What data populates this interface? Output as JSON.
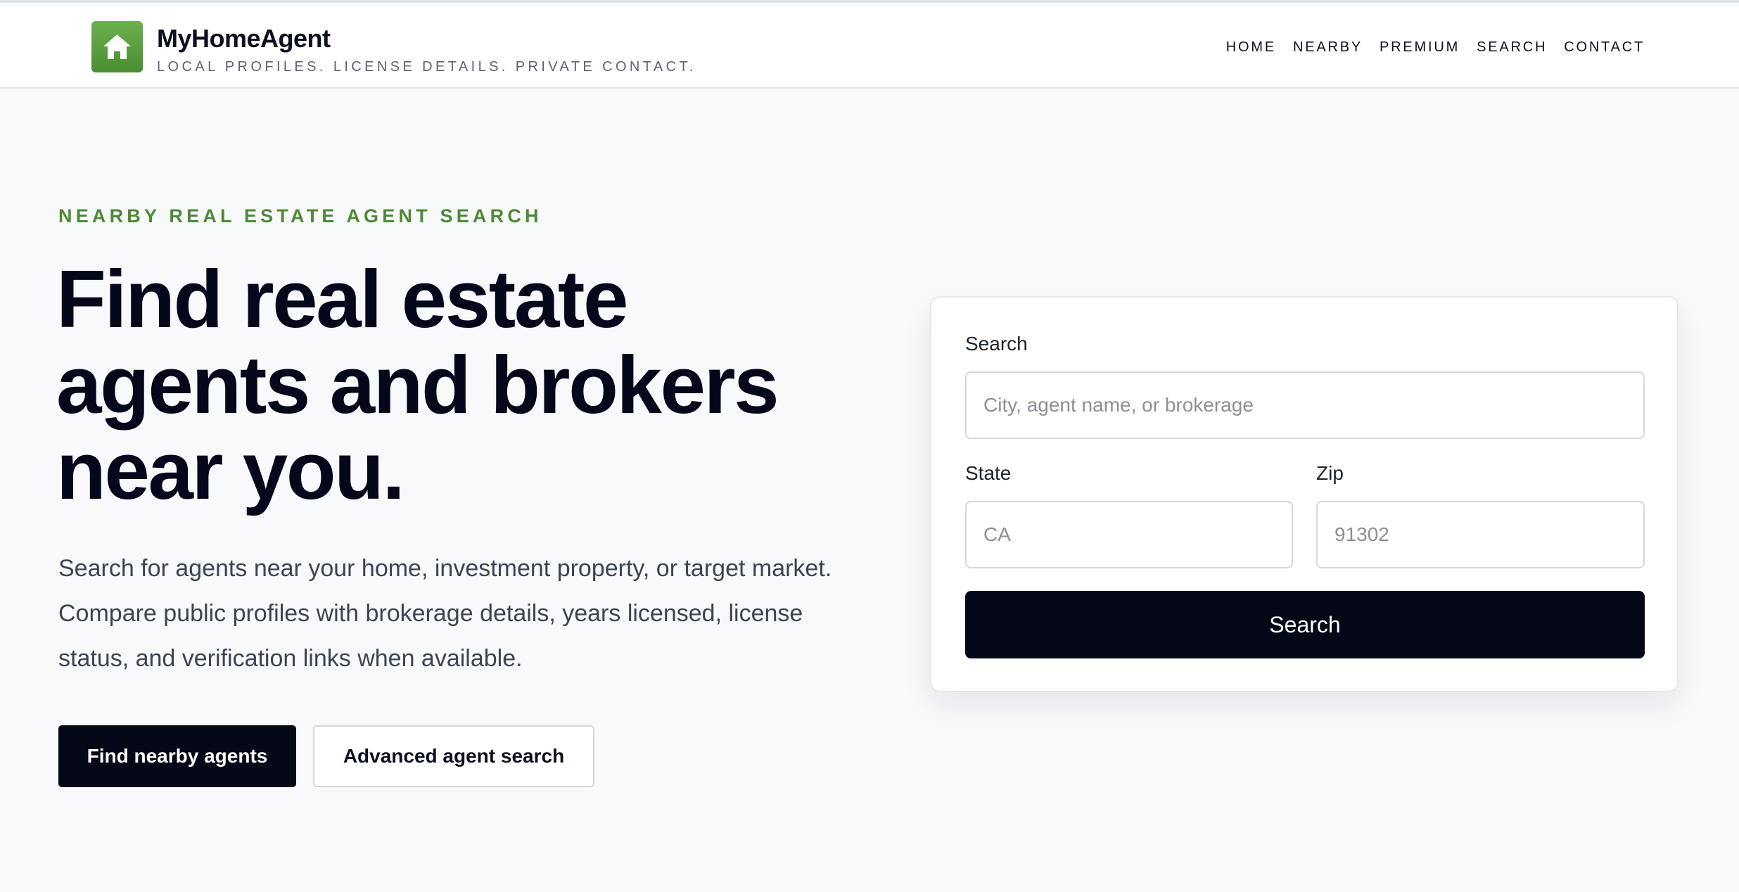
{
  "brand": {
    "name": "MyHomeAgent",
    "tagline": "LOCAL PROFILES. LICENSE DETAILS. PRIVATE CONTACT.",
    "logo_icon": "house-icon",
    "logo_color": "#5a9e40"
  },
  "nav": {
    "items": [
      {
        "label": "HOME"
      },
      {
        "label": "NEARBY"
      },
      {
        "label": "PREMIUM"
      },
      {
        "label": "SEARCH"
      },
      {
        "label": "CONTACT"
      }
    ]
  },
  "hero": {
    "eyebrow": "NEARBY REAL ESTATE AGENT SEARCH",
    "headline_line1": "Find real estate",
    "headline_line2": "agents and brokers",
    "headline_line3": "near you.",
    "lead": "Search for agents near your home, investment property, or target market. Compare public profiles with brokerage details, years licensed, license status, and verification links when available.",
    "primary_button": "Find nearby agents",
    "secondary_button": "Advanced agent search"
  },
  "search_form": {
    "search_label": "Search",
    "search_placeholder": "City, agent name, or brokerage",
    "search_value": "",
    "state_label": "State",
    "state_placeholder": "CA",
    "state_value": "",
    "zip_label": "Zip",
    "zip_placeholder": "91302",
    "zip_value": "",
    "submit_label": "Search"
  },
  "colors": {
    "accent_green": "#4d8a35",
    "primary_dark": "#050817",
    "page_background": "#f8f9fb"
  }
}
